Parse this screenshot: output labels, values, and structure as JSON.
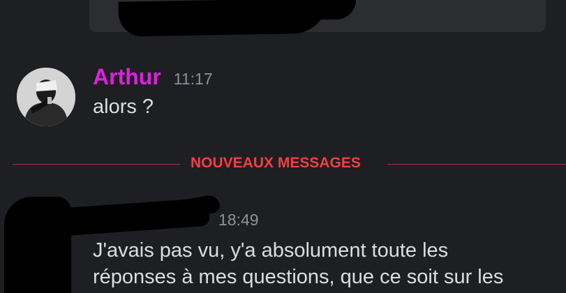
{
  "messages": [
    {
      "author": "Arthur",
      "time": "11:17",
      "text": "alors ?"
    },
    {
      "time": "18:49",
      "lines": [
        "J'avais pas vu, y'a absolument toute les",
        "réponses à mes questions, que ce soit sur les"
      ]
    }
  ],
  "divider": {
    "label": "NOUVEAUX MESSAGES"
  },
  "colors": {
    "background": "#1e1f22",
    "author_name": "#e01ee0",
    "new_messages": "#f23f43",
    "text": "#dbdee1",
    "timestamp": "#8e9297"
  }
}
